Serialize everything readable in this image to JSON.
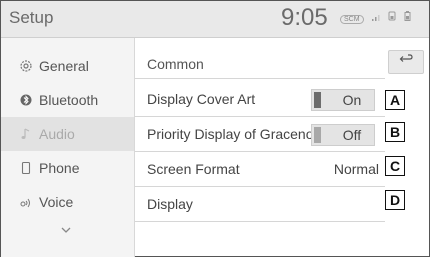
{
  "header": {
    "title": "Setup",
    "clock": "9:05",
    "status_icons": [
      "scm-icon",
      "signal-icon",
      "phone-battery-icon",
      "battery-icon"
    ],
    "scm_label": "SCM"
  },
  "sidebar": {
    "items": [
      {
        "label": "General",
        "icon": "gear-icon"
      },
      {
        "label": "Bluetooth",
        "icon": "bluetooth-icon"
      },
      {
        "label": "Audio",
        "icon": "music-note-icon",
        "active": true
      },
      {
        "label": "Phone",
        "icon": "phone-icon"
      },
      {
        "label": "Voice",
        "icon": "voice-icon"
      }
    ],
    "more_icon": "chevron-down-icon"
  },
  "panel": {
    "section_title": "Common",
    "back_icon": "back-arrow-icon",
    "rows": [
      {
        "label": "Display Cover Art",
        "value": "On",
        "badge": "A"
      },
      {
        "label": "Priority Display of Gracenote",
        "value": "Off",
        "badge": "B"
      },
      {
        "label": "Screen Format",
        "value": "Normal",
        "badge": "C"
      },
      {
        "label": "Display",
        "value": "",
        "badge": "D"
      }
    ]
  },
  "colors": {
    "indicator_on": "#6d6d6d",
    "indicator_off": "#a8a8a8"
  }
}
